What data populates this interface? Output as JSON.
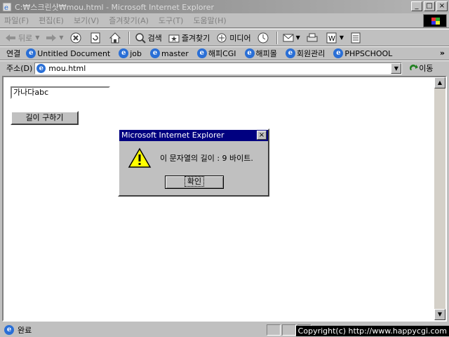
{
  "window": {
    "title": "C:₩스크린샷₩mou.html - Microsoft Internet Explorer",
    "min": "_",
    "max": "□",
    "close": "×"
  },
  "menu": [
    "파일(F)",
    "편집(E)",
    "보기(V)",
    "즐겨찾기(A)",
    "도구(T)",
    "도움말(H)"
  ],
  "toolbar": {
    "back": "뒤로",
    "search": "검색",
    "favorites": "즐겨찾기",
    "media": "미디어"
  },
  "links": {
    "label": "연결",
    "items": [
      "Untitled Document",
      "job",
      "master",
      "해피CGI",
      "해피몰",
      "회원관리",
      "PHPSCHOOL"
    ],
    "more": "»"
  },
  "address": {
    "label": "주소(D)",
    "value": "mou.html",
    "go": "이동"
  },
  "page": {
    "input_value": "가나다abc",
    "button_label": "길이 구하기"
  },
  "dialog": {
    "title": "Microsoft Internet Explorer",
    "message": "이 문자열의 길이 : 9 바이트.",
    "ok": "확인",
    "close": "×"
  },
  "status": {
    "text": "완료",
    "copyright": "Copyright(c) http://www.happycgi.com"
  }
}
